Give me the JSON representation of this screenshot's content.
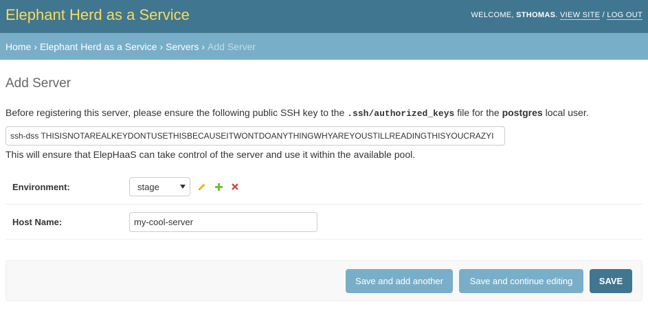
{
  "header": {
    "site_name": "Elephant Herd as a Service",
    "welcome": "WELCOME,",
    "username": "STHOMAS",
    "view_site": "VIEW SITE",
    "separator": "/",
    "log_out": "LOG OUT"
  },
  "breadcrumbs": {
    "home": "Home",
    "app": "Elephant Herd as a Service",
    "model": "Servers",
    "current": "Add Server",
    "separator": "›"
  },
  "page": {
    "title": "Add Server",
    "intro_before": "Before registering this server, please ensure the following public SSH key to the ",
    "intro_path": ".ssh/authorized_keys",
    "intro_middle": " file for the ",
    "intro_user": "postgres",
    "intro_after": " local user.",
    "ssh_key": "ssh-dss THISISNOTAREALKEYDONTUSETHISBECAUSEITWONTDOANYTHINGWHYAREYOUSTILLREADINGTHISYOUCRAZYI",
    "after_note": "This will ensure that ElepHaaS can take control of the server and use it within the available pool."
  },
  "form": {
    "environment_label": "Environment:",
    "environment_value": "stage",
    "host_label": "Host Name:",
    "host_value": "my-cool-server"
  },
  "icons": {
    "edit": "pencil-icon",
    "add": "plus-icon",
    "delete": "x-icon"
  },
  "colors": {
    "header_bg": "#417690",
    "branding": "#f5dd5d",
    "breadcrumb_bg": "#79aec8",
    "button_light": "#79aec8",
    "button_primary": "#417690",
    "edit_icon": "#efb80b",
    "add_icon": "#70bf2b",
    "delete_icon": "#dd4646"
  },
  "submit": {
    "save_add_another": "Save and add another",
    "save_continue": "Save and continue editing",
    "save": "SAVE"
  }
}
